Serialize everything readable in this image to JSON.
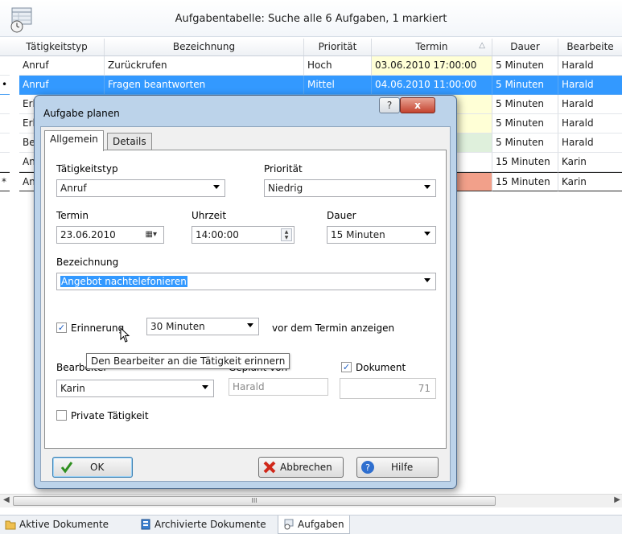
{
  "window": {
    "title": "Aufgabentabelle: Suche alle 6 Aufgaben, 1 markiert"
  },
  "grid": {
    "columns": [
      "Tätigkeitstyp",
      "Bezeichnung",
      "Priorität",
      "Termin",
      "Dauer",
      "Bearbeite"
    ],
    "rows": [
      {
        "marker": "",
        "typ": "Anruf",
        "bez": "Zurückrufen",
        "prio": "Hoch",
        "termin": "03.06.2010 17:00:00",
        "dauer": "5 Minuten",
        "bearb": "Harald"
      },
      {
        "marker": "•",
        "typ": "Anruf",
        "bez": "Fragen beantworten",
        "prio": "Mittel",
        "termin": "04.06.2010 11:00:00",
        "dauer": "5 Minuten",
        "bearb": "Harald"
      },
      {
        "marker": "",
        "typ": "Erl",
        "bez": "",
        "prio": "",
        "termin": "00",
        "dauer": "5 Minuten",
        "bearb": "Harald"
      },
      {
        "marker": "",
        "typ": "Erl",
        "bez": "",
        "prio": "",
        "termin": "00",
        "dauer": "5 Minuten",
        "bearb": "Harald"
      },
      {
        "marker": "",
        "typ": "Be",
        "bez": "",
        "prio": "",
        "termin": "00",
        "dauer": "5 Minuten",
        "bearb": "Harald"
      },
      {
        "marker": "",
        "typ": "An",
        "bez": "",
        "prio": "",
        "termin": "00",
        "dauer": "15 Minuten",
        "bearb": "Karin"
      },
      {
        "marker": "*",
        "typ": "An",
        "bez": "",
        "prio": "",
        "termin": "",
        "dauer": "15 Minuten",
        "bearb": "Karin"
      }
    ],
    "scroll_thumb": "III"
  },
  "bottom_tabs": [
    "Aktive Dokumente",
    "Archivierte Dokumente",
    "Aufgaben"
  ],
  "dialog": {
    "title": "Aufgabe planen",
    "help_glyph": "?",
    "close_glyph": "x",
    "tabs": [
      "Allgemein",
      "Details"
    ],
    "taetigkeitstyp_label": "Tätigkeitstyp",
    "taetigkeitstyp_value": "Anruf",
    "prioritaet_label": "Priorität",
    "prioritaet_value": "Niedrig",
    "termin_label": "Termin",
    "termin_value": "23.06.2010",
    "uhrzeit_label": "Uhrzeit",
    "uhrzeit_value": "14:00:00",
    "dauer_label": "Dauer",
    "dauer_value": "15 Minuten",
    "bezeichnung_label": "Bezeichnung",
    "bezeichnung_value": "Angebot nachtelefonieren",
    "erinnerung_label": "Erinnerung",
    "erinnerung_value": "30 Minuten",
    "erinnerung_suffix": "vor dem Termin anzeigen",
    "tooltip": "Den Bearbeiter an die Tätigkeit erinnern",
    "bearbeiter_label": "Bearbeiter",
    "bearbeiter_value": "Karin",
    "geplant_von_label": "Geplant von",
    "geplant_von_value": "Harald",
    "dokument_label": "Dokument",
    "dokument_value": "71",
    "private_label": "Private Tätigkeit",
    "ok_label": "OK",
    "abbrechen_label": "Abbrechen",
    "hilfe_label": "Hilfe"
  },
  "colors": {
    "selection": "#3399ff",
    "termin_yellow": "#ffffd6",
    "termin_green": "#dff0dc",
    "termin_red": "#f2a08a",
    "dialog_frame": "#bcd3ea"
  }
}
